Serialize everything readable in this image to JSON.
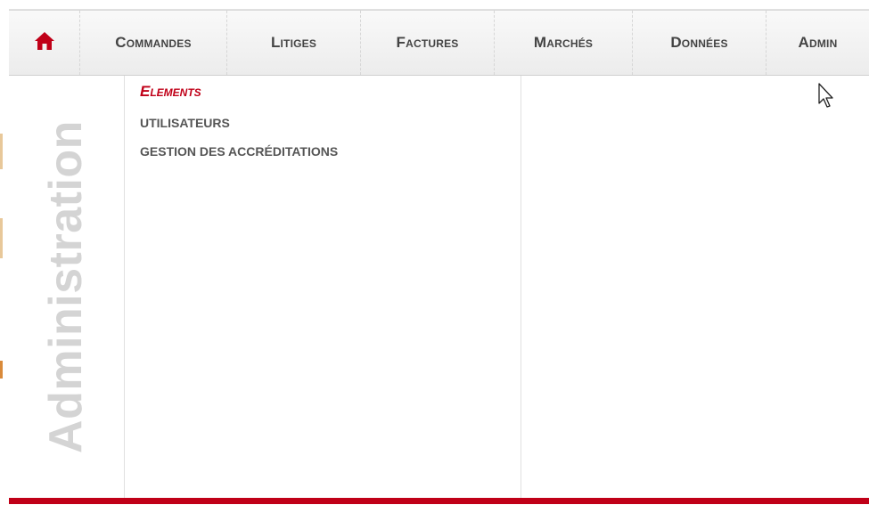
{
  "nav": {
    "home_icon": "house-icon",
    "accent_color": "#c00018",
    "items": [
      {
        "label": "Commandes"
      },
      {
        "label": "Litiges"
      },
      {
        "label": "Factures"
      },
      {
        "label": "Marchés"
      },
      {
        "label": "Données"
      },
      {
        "label": "Admin"
      }
    ]
  },
  "dropdown": {
    "section_title": "Administration",
    "links": [
      {
        "label": "Elements",
        "active": true
      },
      {
        "label": "UTILISATEURS"
      },
      {
        "label": "GESTION DES ACCRÉDITATIONS"
      }
    ]
  }
}
